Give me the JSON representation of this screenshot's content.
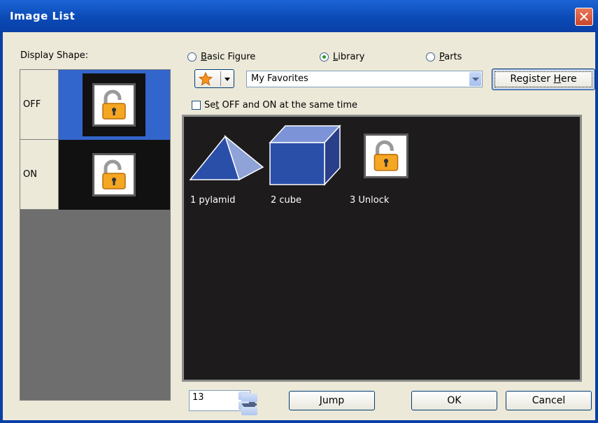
{
  "window": {
    "title": "Image List",
    "close_glyph": "✕"
  },
  "display_shape": {
    "label": "Display Shape:",
    "rows": [
      {
        "state": "OFF",
        "icon": "padlock-unlocked-icon"
      },
      {
        "state": "ON",
        "icon": "padlock-unlocked-icon"
      }
    ]
  },
  "source_options": [
    {
      "prefix": "",
      "accel": "B",
      "suffix": "asic Figure",
      "selected": false
    },
    {
      "prefix": "",
      "accel": "L",
      "suffix": "ibrary",
      "selected": true
    },
    {
      "prefix": "",
      "accel": "P",
      "suffix": "arts",
      "selected": false
    }
  ],
  "library_select": {
    "value": "My Favorites",
    "icon": "star-icon"
  },
  "register": {
    "prefix": "Register ",
    "accel": "H",
    "suffix": "ere"
  },
  "sync_checkbox": {
    "prefix": "Se",
    "accel": "t",
    "suffix": " OFF and ON at the same time",
    "checked": false
  },
  "images": [
    {
      "label": "1 pylamid",
      "icon": "pyramid-icon"
    },
    {
      "label": "2 cube",
      "icon": "cube-icon"
    },
    {
      "label": "3 Unlock",
      "icon": "padlock-unlocked-icon"
    }
  ],
  "jump_number": "13",
  "buttons": {
    "jump": {
      "prefix": "",
      "accel": "J",
      "suffix": "ump"
    },
    "ok": "OK",
    "cancel": "Cancel"
  },
  "colors": {
    "title_bar": "#0b4ab6",
    "selected_row": "#3366cc",
    "canvas": "#1d1b1c",
    "shape_blue": "#2a4fa8"
  }
}
